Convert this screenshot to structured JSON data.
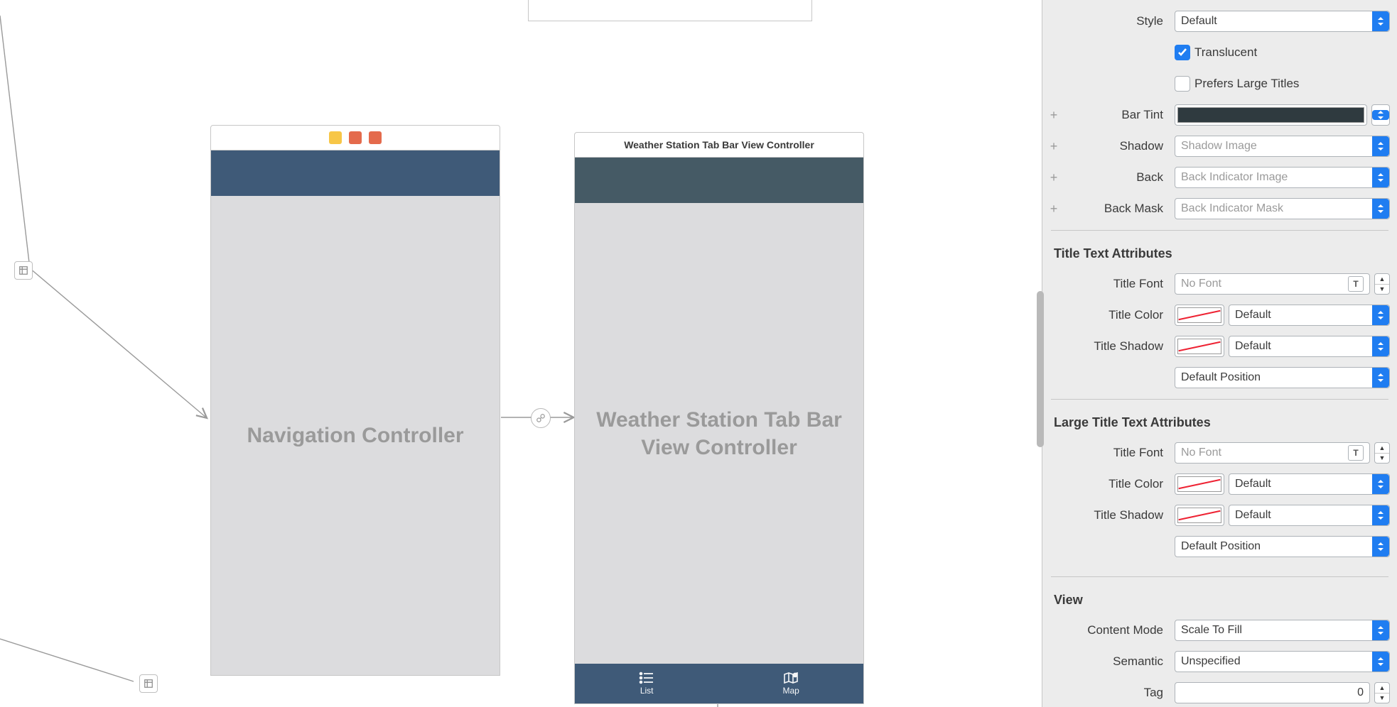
{
  "canvas": {
    "left_scene": {
      "title": "Navigation Controller"
    },
    "right_scene": {
      "header": "Weather Station Tab Bar View Controller",
      "title_line1": "Weather Station Tab Bar",
      "title_line2": "View Controller",
      "tab_list": "List",
      "tab_map": "Map"
    }
  },
  "inspector": {
    "style": {
      "label": "Style",
      "value": "Default"
    },
    "translucent": {
      "label": "Translucent",
      "checked": true
    },
    "prefers_large": {
      "label": "Prefers Large Titles",
      "checked": false
    },
    "bar_tint": {
      "label": "Bar Tint",
      "color": "#2f3a3f"
    },
    "shadow": {
      "label": "Shadow",
      "placeholder": "Shadow Image"
    },
    "back": {
      "label": "Back",
      "placeholder": "Back Indicator Image"
    },
    "back_mask": {
      "label": "Back Mask",
      "placeholder": "Back Indicator Mask"
    },
    "title_attrs_header": "Title Text Attributes",
    "title_font": {
      "label": "Title Font",
      "placeholder": "No Font"
    },
    "title_color": {
      "label": "Title Color",
      "value": "Default"
    },
    "title_shadow": {
      "label": "Title Shadow",
      "value": "Default"
    },
    "title_pos": {
      "value": "Default Position"
    },
    "large_attrs_header": "Large Title Text Attributes",
    "large_font": {
      "label": "Title Font",
      "placeholder": "No Font"
    },
    "large_color": {
      "label": "Title Color",
      "value": "Default"
    },
    "large_shadow": {
      "label": "Title Shadow",
      "value": "Default"
    },
    "large_pos": {
      "value": "Default Position"
    },
    "view_header": "View",
    "content_mode": {
      "label": "Content Mode",
      "value": "Scale To Fill"
    },
    "semantic": {
      "label": "Semantic",
      "value": "Unspecified"
    },
    "tag": {
      "label": "Tag",
      "value": "0"
    }
  }
}
